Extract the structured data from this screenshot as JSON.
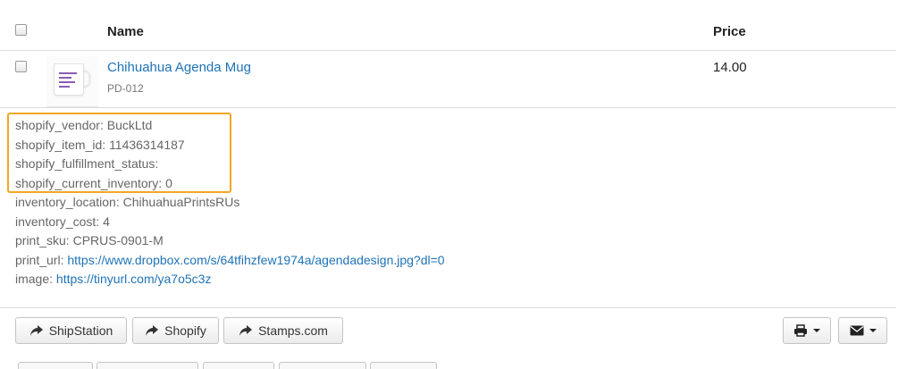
{
  "table": {
    "header": {
      "name_label": "Name",
      "price_label": "Price"
    },
    "item": {
      "name": "Chihuahua Agenda Mug",
      "sku": "PD-012",
      "price": "14.00"
    }
  },
  "properties": [
    {
      "key": "shopify_vendor:",
      "value": "BuckLtd"
    },
    {
      "key": "shopify_item_id:",
      "value": "11436314187"
    },
    {
      "key": "shopify_fulfillment_status:",
      "value": ""
    },
    {
      "key": "shopify_current_inventory:",
      "value": "0"
    },
    {
      "key": "inventory_location:",
      "value": "ChihuahuaPrintsRUs"
    },
    {
      "key": "inventory_cost:",
      "value": "4"
    },
    {
      "key": "print_sku:",
      "value": "CPRUS-0901-M"
    },
    {
      "key": "print_url:",
      "value": "https://www.dropbox.com/s/64tfihzfew1974a/agendadesign.jpg?dl=0"
    },
    {
      "key": "image:",
      "value": "https://tinyurl.com/ya7o5c3z"
    }
  ],
  "actions": {
    "shipstation": "ShipStation",
    "shopify": "Shopify",
    "stamps": "Stamps.com"
  },
  "icons": {
    "share": "share-arrow-icon",
    "print": "printer-icon",
    "email": "envelope-icon",
    "caret": "chevron-down-icon"
  },
  "colors": {
    "link": "#1f73b7",
    "highlight": "#f5a623",
    "product_accent": "#8b5bb5"
  }
}
